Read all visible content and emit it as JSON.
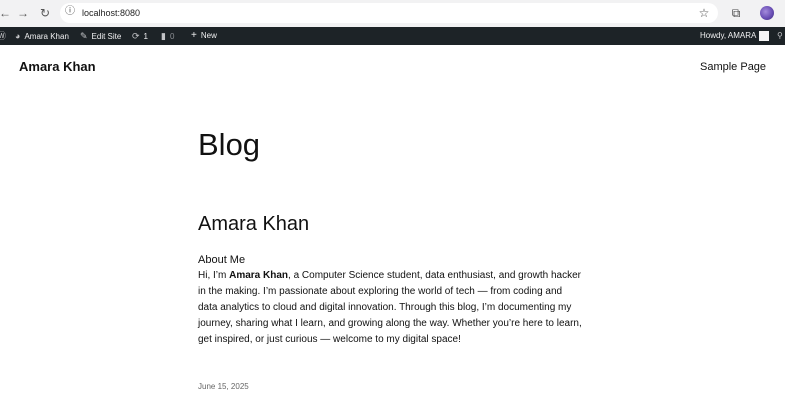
{
  "browser": {
    "url": "localhost:8080",
    "icons": [
      "back-icon",
      "forward-icon",
      "reload-icon",
      "info-icon",
      "bookmark-star-icon",
      "extensions-icon",
      "profile-avatar"
    ]
  },
  "admin_bar": {
    "site_name": "Amara Khan",
    "edit_site": "Edit Site",
    "updates_count": "1",
    "comments_count": "0",
    "new_label": "New",
    "howdy": "Howdy, AMARA"
  },
  "site": {
    "title": "Amara Khan",
    "nav": {
      "sample_page": "Sample Page"
    }
  },
  "main": {
    "heading": "Blog",
    "post": {
      "title": "Amara Khan",
      "about_title": "About Me",
      "body_prefix": "Hi, I’m ",
      "body_name": "Amara Khan",
      "body_rest": ", a Computer Science student, data enthusiast, and growth hacker in the making. I’m passionate about exploring the world of tech — from coding and data analytics to cloud and digital innovation. Through this blog, I’m documenting my journey, sharing what I learn, and growing along the way. Whether you’re here to learn, get inspired, or just curious — welcome to my digital space!",
      "date": "June 15, 2025"
    }
  }
}
